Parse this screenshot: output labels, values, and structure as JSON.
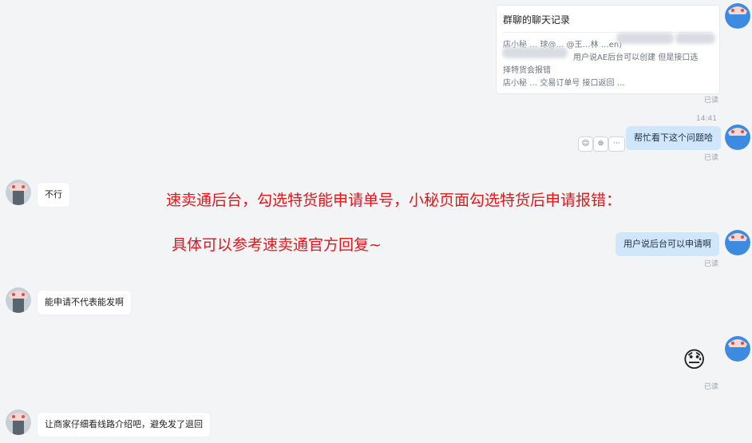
{
  "card": {
    "title": "群聊的聊天记录",
    "line1": "店小秘 … 球@… @王…林 …en)",
    "line2": "用户说AE后台可以创建 但是接口选",
    "line3": "择特货会报错",
    "line4": "店小秘 … 交易订单号    接口返回 …",
    "read": "已读"
  },
  "timestamp": "14:41",
  "messages": {
    "m1": {
      "text": "帮忙看下这个问题哈",
      "read": "已读"
    },
    "m2": {
      "text": "不行"
    },
    "m3": {
      "text": "用户说后台可以申请啊",
      "read": "已读"
    },
    "m4": {
      "text": "能申请不代表能发啊"
    },
    "m5": {
      "emoji": "😓",
      "read": "已读"
    },
    "m6": {
      "text": "让商家仔细看线路介绍吧，避免发了退回"
    }
  },
  "actions": {
    "emoji": "☺",
    "reply": "⊜",
    "more": "···"
  },
  "annotation": {
    "line1": "速卖通后台，勾选特货能申请单号，小秘页面勾选特货后申请报错：",
    "line2": "具体可以参考速卖通官方回复~",
    "color": "#e4161c"
  },
  "colors": {
    "background": "#f3f4f6",
    "outgoing": "#cfe6fb",
    "incoming": "#ffffff"
  }
}
